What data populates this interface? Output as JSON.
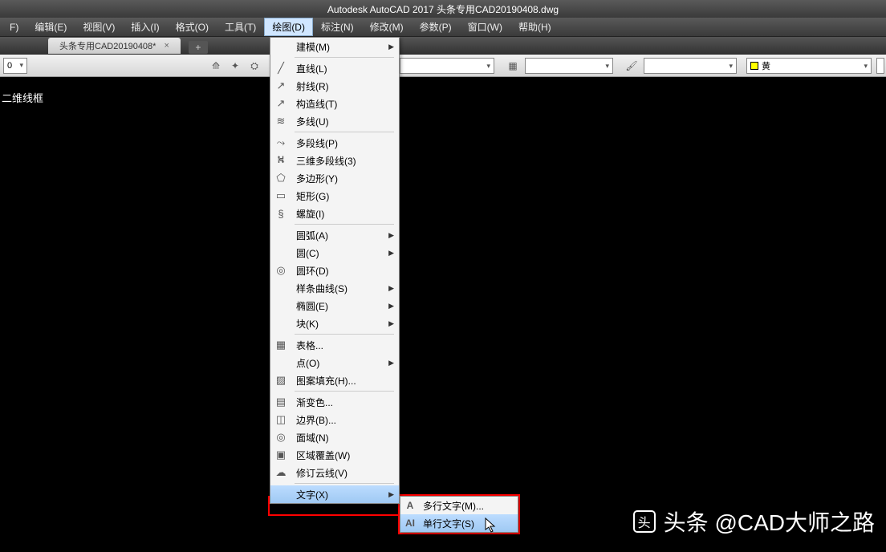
{
  "title": "Autodesk AutoCAD 2017    头条专用CAD20190408.dwg",
  "menubar": [
    "F)",
    "编辑(E)",
    "视图(V)",
    "插入(I)",
    "格式(O)",
    "工具(T)",
    "绘图(D)",
    "标注(N)",
    "修改(M)",
    "参数(P)",
    "窗口(W)",
    "帮助(H)"
  ],
  "menubar_highlight_index": 6,
  "tab": {
    "label": "头条专用CAD20190408*"
  },
  "toolbar": {
    "dd1": "0",
    "color_label": "黄"
  },
  "canvas_label": "二维线框",
  "dropdown": {
    "items": [
      {
        "label": "建模(M)",
        "icon": "",
        "sub": true
      },
      "sep",
      {
        "label": "直线(L)",
        "icon": "╱"
      },
      {
        "label": "射线(R)",
        "icon": "↗"
      },
      {
        "label": "构造线(T)",
        "icon": "↗"
      },
      {
        "label": "多线(U)",
        "icon": "≋"
      },
      "sep",
      {
        "label": "多段线(P)",
        "icon": "⤳"
      },
      {
        "label": "三维多段线(3)",
        "icon": "⛕"
      },
      {
        "label": "多边形(Y)",
        "icon": "⬠"
      },
      {
        "label": "矩形(G)",
        "icon": "▭"
      },
      {
        "label": "螺旋(I)",
        "icon": "§"
      },
      "sep",
      {
        "label": "圆弧(A)",
        "sub": true
      },
      {
        "label": "圆(C)",
        "sub": true
      },
      {
        "label": "圆环(D)",
        "icon": "◎"
      },
      {
        "label": "样条曲线(S)",
        "sub": true
      },
      {
        "label": "椭圆(E)",
        "sub": true
      },
      {
        "label": "块(K)",
        "sub": true
      },
      "sep",
      {
        "label": "表格...",
        "icon": "▦"
      },
      {
        "label": "点(O)",
        "sub": true
      },
      {
        "label": "图案填充(H)...",
        "icon": "▨"
      },
      "sep",
      {
        "label": "渐变色...",
        "icon": "▤"
      },
      {
        "label": "边界(B)...",
        "icon": "◫"
      },
      {
        "label": "面域(N)",
        "icon": "◎"
      },
      {
        "label": "区域覆盖(W)",
        "icon": "▣"
      },
      {
        "label": "修订云线(V)",
        "icon": "☁"
      },
      "sep",
      {
        "label": "文字(X)",
        "sub": true,
        "selected": true
      }
    ]
  },
  "submenu": {
    "items": [
      {
        "icon": "A",
        "label": "多行文字(M)..."
      },
      {
        "icon": "AI",
        "label": "单行文字(S)",
        "selected": true
      }
    ]
  },
  "watermark": "头条 @CAD大师之路"
}
